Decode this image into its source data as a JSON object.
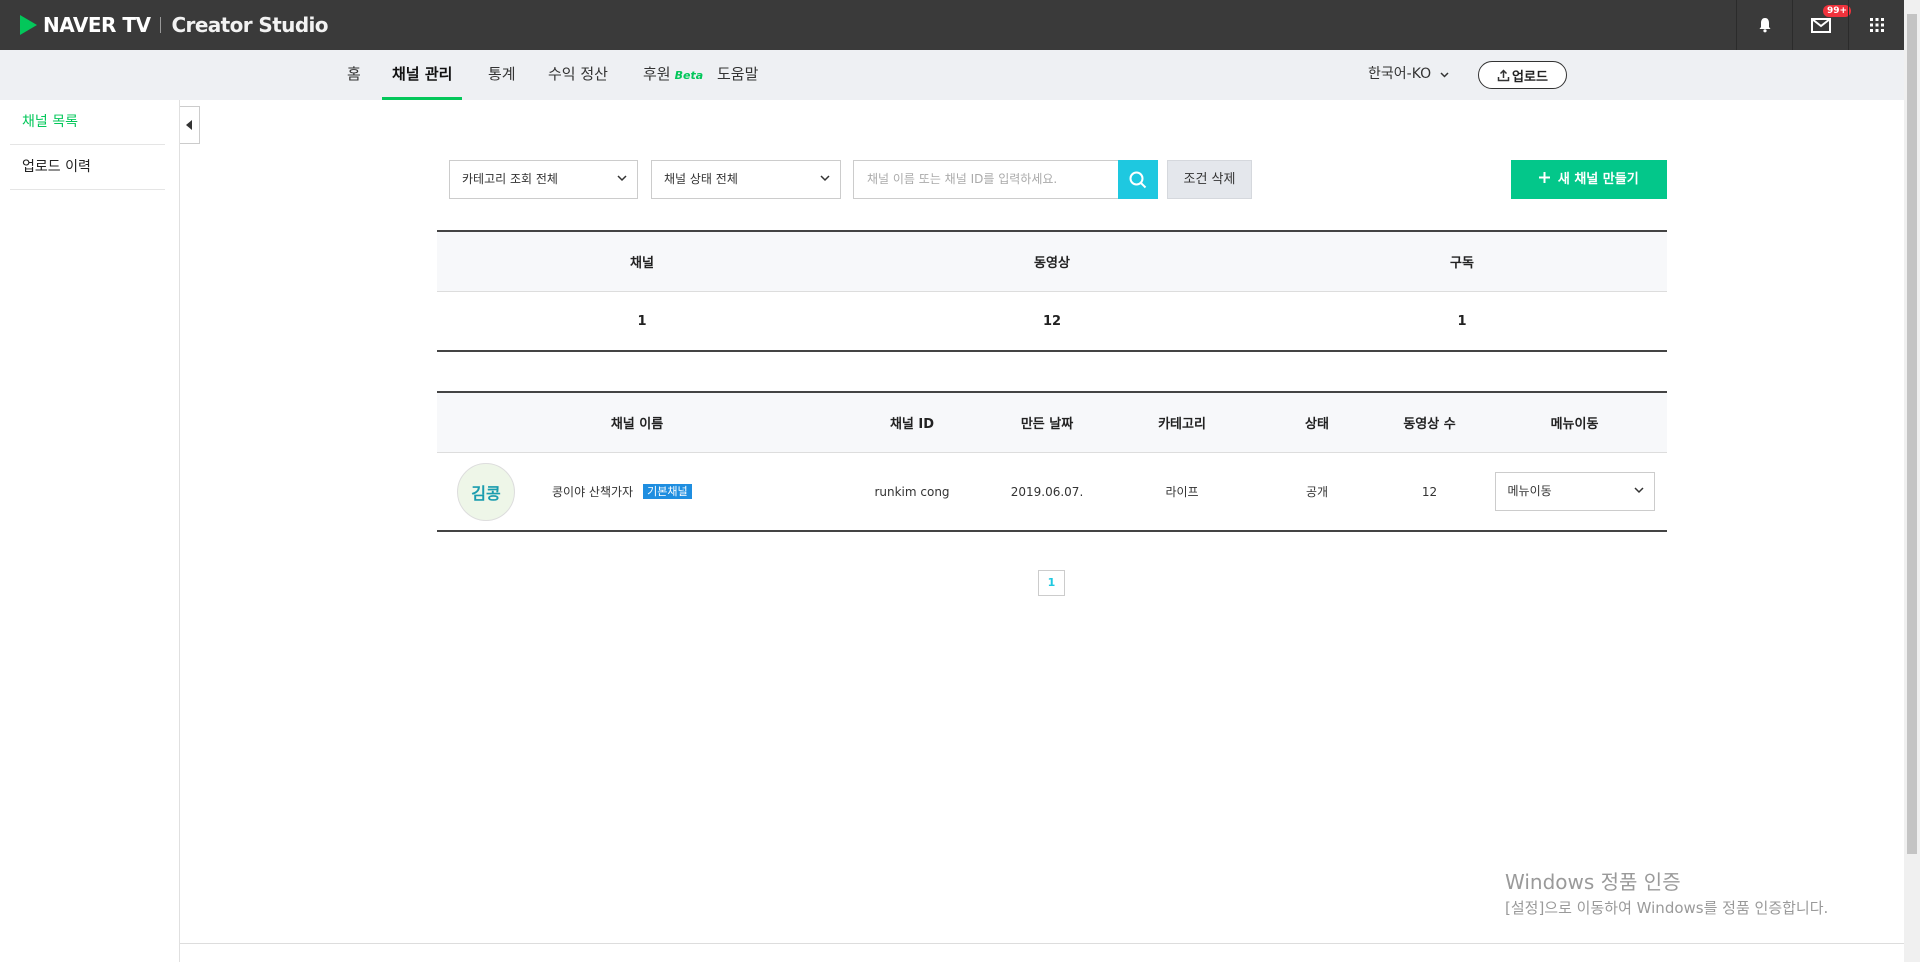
{
  "header": {
    "brand": "NAVER TV",
    "studio": "Creator Studio",
    "notification_badge": "99+",
    "icons": [
      "bell-icon",
      "mail-icon",
      "apps-grid-icon"
    ]
  },
  "nav": {
    "items": [
      {
        "label": "홈"
      },
      {
        "label": "채널 관리",
        "active": true
      },
      {
        "label": "통계"
      },
      {
        "label": "수익 정산"
      },
      {
        "label": "후원"
      },
      {
        "label": "도움말"
      }
    ],
    "beta_label": "Beta",
    "language": "한국어-KO",
    "upload_label": "업로드"
  },
  "sidebar": {
    "items": [
      {
        "label": "채널 목록",
        "active": true
      },
      {
        "label": "업로드 이력"
      }
    ]
  },
  "filters": {
    "category": "카테고리 조회 전체",
    "status": "채널 상태 전체",
    "search_placeholder": "채널 이름 또는 채널 ID를 입력하세요.",
    "reset_label": "조건 삭제",
    "new_channel_label": "새 채널 만들기"
  },
  "summary": {
    "headers": [
      "채널",
      "동영상",
      "구독"
    ],
    "values": [
      "1",
      "12",
      "1"
    ]
  },
  "channels": {
    "headers": [
      "채널 이름",
      "채널 ID",
      "만든 날짜",
      "카테고리",
      "상태",
      "동영상 수",
      "메뉴이동"
    ],
    "rows": [
      {
        "avatar_text": "김콩",
        "name": "콩이야 산책가자",
        "tag": "기본채널",
        "id": "runkim cong",
        "created": "2019.06.07.",
        "category": "라이프",
        "status": "공개",
        "videos": "12",
        "menu": "메뉴이동"
      }
    ]
  },
  "pagination": {
    "current": "1"
  },
  "watermark": {
    "line1": "Windows 정품 인증",
    "line2": "[설정]으로 이동하여 Windows를 정품 인증합니다."
  },
  "colors": {
    "accent_green": "#03c75a",
    "button_green": "#03c78a",
    "search_blue": "#1ec8e0",
    "topbar": "#3a3a3a"
  }
}
